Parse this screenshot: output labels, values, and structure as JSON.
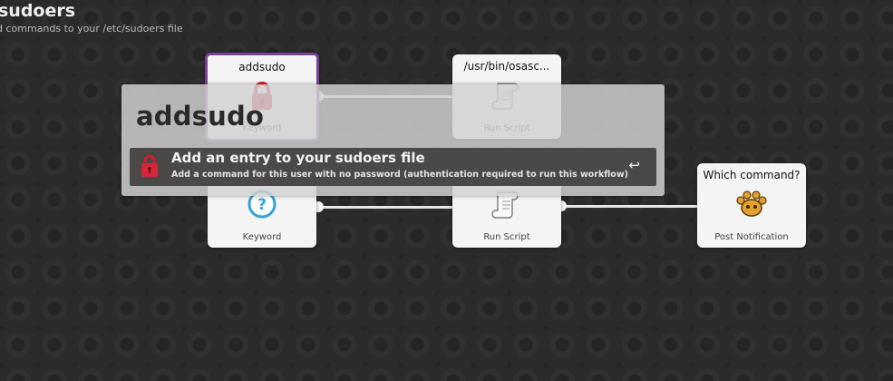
{
  "header": {
    "title": "sudoers",
    "subtitle": "d commands to your /etc/sudoers file"
  },
  "nodes": [
    {
      "title": "addsudo",
      "type": "Keyword",
      "icon": "lock-icon"
    },
    {
      "title": "/usr/bin/osasc...",
      "type": "Run Script",
      "icon": "script-scroll-icon"
    },
    {
      "title": "",
      "type": "Keyword",
      "icon": "help-icon"
    },
    {
      "title": "",
      "type": "Run Script",
      "icon": "script-scroll-icon"
    },
    {
      "title": "Which command?",
      "type": "Post Notification",
      "icon": "growl-paw-icon"
    }
  ],
  "launcher": {
    "query": "addsudo",
    "result": {
      "title": "Add an entry to your sudoers file",
      "subtitle": "Add a command for this user with no password (authentication required to run this workflow)",
      "action_glyph": "↩",
      "icon": "lock-icon"
    }
  },
  "colors": {
    "selection": "#7a4197",
    "lock": "#d6263a",
    "help": "#2ea5d8",
    "background": "#2c2b2b"
  }
}
